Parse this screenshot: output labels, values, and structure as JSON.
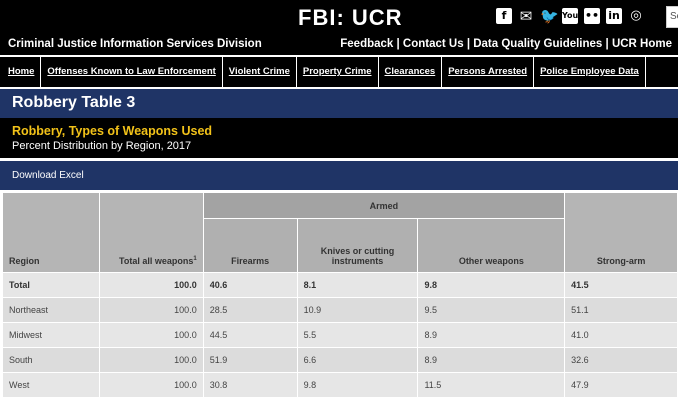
{
  "header": {
    "site_title": "FBI: UCR",
    "social_icons": [
      "facebook-icon",
      "email-icon",
      "twitter-icon",
      "youtube-icon",
      "flickr-icon",
      "linkedin-icon",
      "instagram-icon"
    ],
    "search_placeholder": "Se"
  },
  "subheader": {
    "division": "Criminal Justice Information Services Division",
    "links": [
      "Feedback",
      "Contact Us",
      "Data Quality Guidelines",
      "UCR Home"
    ],
    "separator": " | "
  },
  "nav": {
    "items": [
      "Home",
      "Offenses Known to Law Enforcement",
      "Violent Crime",
      "Property Crime",
      "Clearances",
      "Persons Arrested",
      "Police Employee Data"
    ]
  },
  "page": {
    "table_title": "Robbery Table 3",
    "subtitle": "Robbery, Types of Weapons Used",
    "sub_subtitle": "Percent Distribution by Region, 2017",
    "download_label": "Download Excel"
  },
  "table": {
    "headers": {
      "region": "Region",
      "total_weapons": "Total all weapons",
      "total_weapons_sup": "1",
      "armed": "Armed",
      "firearms": "Firearms",
      "knives": "Knives or cutting instruments",
      "other_weapons": "Other weapons",
      "strong_arm": "Strong-arm"
    },
    "rows": [
      {
        "region": "Total",
        "total": "100.0",
        "firearms": "40.6",
        "knives": "8.1",
        "other": "9.8",
        "strong_arm": "41.5"
      },
      {
        "region": "Northeast",
        "total": "100.0",
        "firearms": "28.5",
        "knives": "10.9",
        "other": "9.5",
        "strong_arm": "51.1"
      },
      {
        "region": "Midwest",
        "total": "100.0",
        "firearms": "44.5",
        "knives": "5.5",
        "other": "8.9",
        "strong_arm": "41.0"
      },
      {
        "region": "South",
        "total": "100.0",
        "firearms": "51.9",
        "knives": "6.6",
        "other": "8.9",
        "strong_arm": "32.6"
      },
      {
        "region": "West",
        "total": "100.0",
        "firearms": "30.8",
        "knives": "9.8",
        "other": "11.5",
        "strong_arm": "47.9"
      }
    ]
  },
  "colors": {
    "header_black": "#000000",
    "title_blue": "#1f3466",
    "subtitle_gold": "#f2c219"
  }
}
